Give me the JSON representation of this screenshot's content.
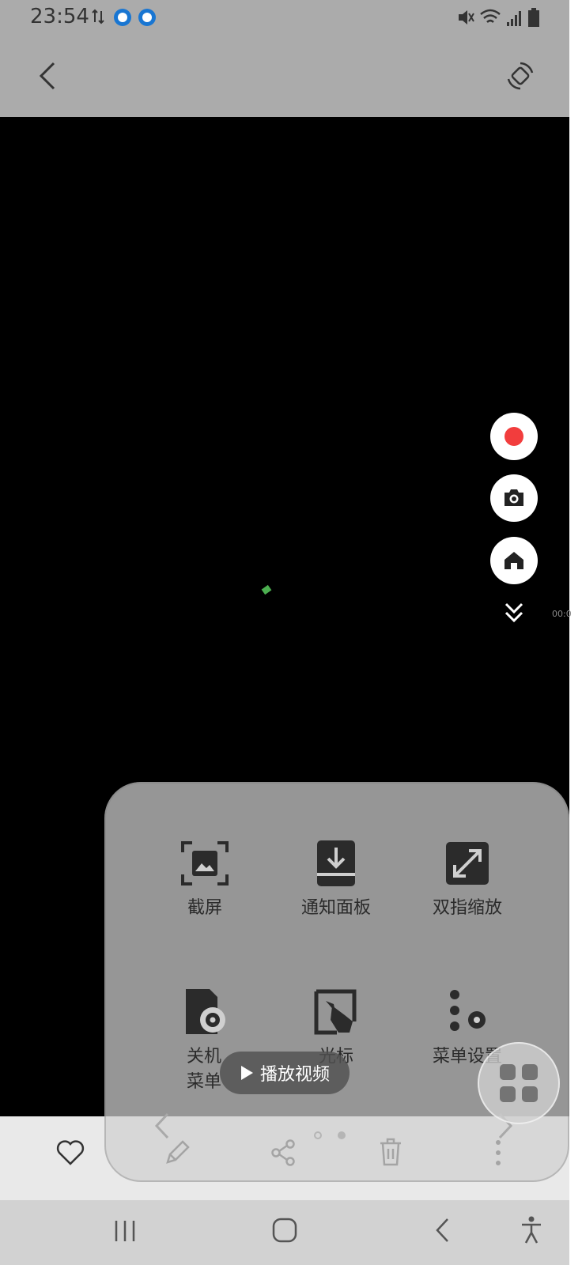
{
  "status_bar": {
    "time": "23:54"
  },
  "video": {
    "timestamp": "00:0"
  },
  "menu": {
    "items": [
      {
        "label": "截屏",
        "icon": "screenshot-icon"
      },
      {
        "label": "通知面板",
        "icon": "notification-panel-icon"
      },
      {
        "label": "双指缩放",
        "icon": "pinch-zoom-icon"
      },
      {
        "label": "关机\n菜单",
        "icon": "power-menu-icon"
      },
      {
        "label": "光标",
        "icon": "cursor-icon"
      },
      {
        "label": "菜单设置",
        "icon": "menu-settings-icon"
      }
    ],
    "page_indicator": {
      "pages": 2,
      "current": 2
    }
  },
  "play_button": {
    "label": "播放视频"
  },
  "colors": {
    "record": "#f23d3d",
    "status_bar_bg": "#ababab",
    "video_bg": "#000000",
    "green_dot": "#4caf50"
  }
}
